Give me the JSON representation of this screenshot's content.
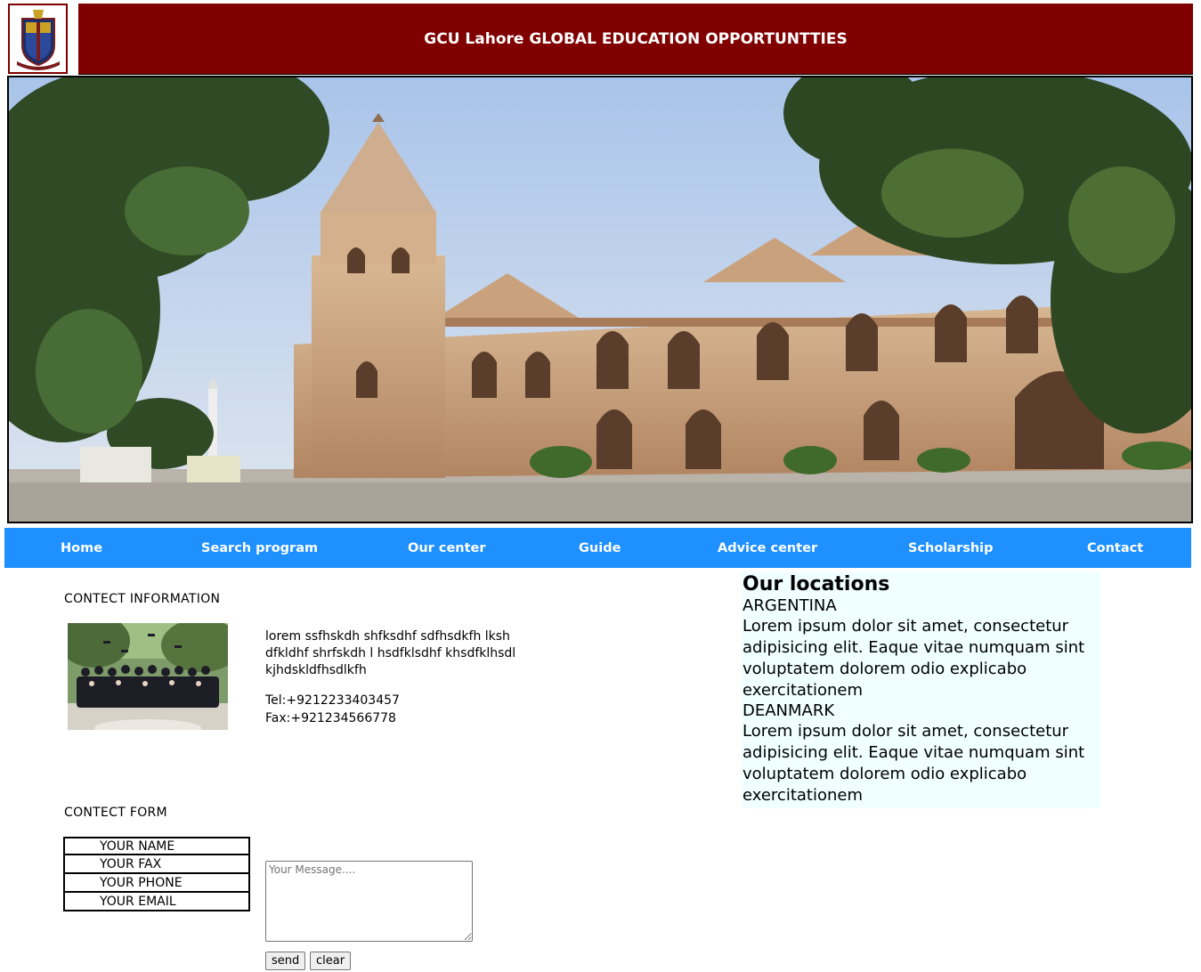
{
  "header": {
    "title": "GCU Lahore GLOBAL EDUCATION OPPORTUNTTIES",
    "logo_icon": "gcu-crest-icon",
    "bg_color": "#800000"
  },
  "hero": {
    "image": "gcu-main-building-photo"
  },
  "nav": {
    "bg_color": "#1e90ff",
    "items": [
      "Home",
      "Search program",
      "Our center",
      "Guide",
      "Advice center",
      "Scholarship",
      "Contact"
    ]
  },
  "contact_info": {
    "heading": "CONTECT INFORMATION",
    "photo": "graduation-group-photo",
    "text": "lorem ssfhskdh shfksdhf sdfhsdkfh lksh dfkldhf shrfskdh l hsdfklsdhf khsdfklhsdl kjhdskldfhsdlkfh",
    "tel": "Tel:+9212233403457",
    "fax": "Fax:+921234566778"
  },
  "locations": {
    "title": "Our locations",
    "bg_color": "#f0ffff",
    "items": [
      {
        "name": "ARGENTINA",
        "text": "Lorem ipsum dolor sit amet, consectetur adipisicing elit. Eaque vitae numquam sint voluptatem dolorem odio explicabo exercitationem"
      },
      {
        "name": "DEANMARK",
        "text": "Lorem ipsum dolor sit amet, consectetur adipisicing elit. Eaque vitae numquam sint voluptatem dolorem odio explicabo exercitationem"
      }
    ]
  },
  "contact_form": {
    "heading": "CONTECT FORM",
    "name_placeholder": "YOUR NAME",
    "fax_placeholder": "YOUR FAX",
    "phone_placeholder": "YOUR PHONE",
    "email_placeholder": "YOUR EMAIL",
    "message_placeholder": "Your Message....",
    "send_label": "send",
    "clear_label": "clear"
  }
}
